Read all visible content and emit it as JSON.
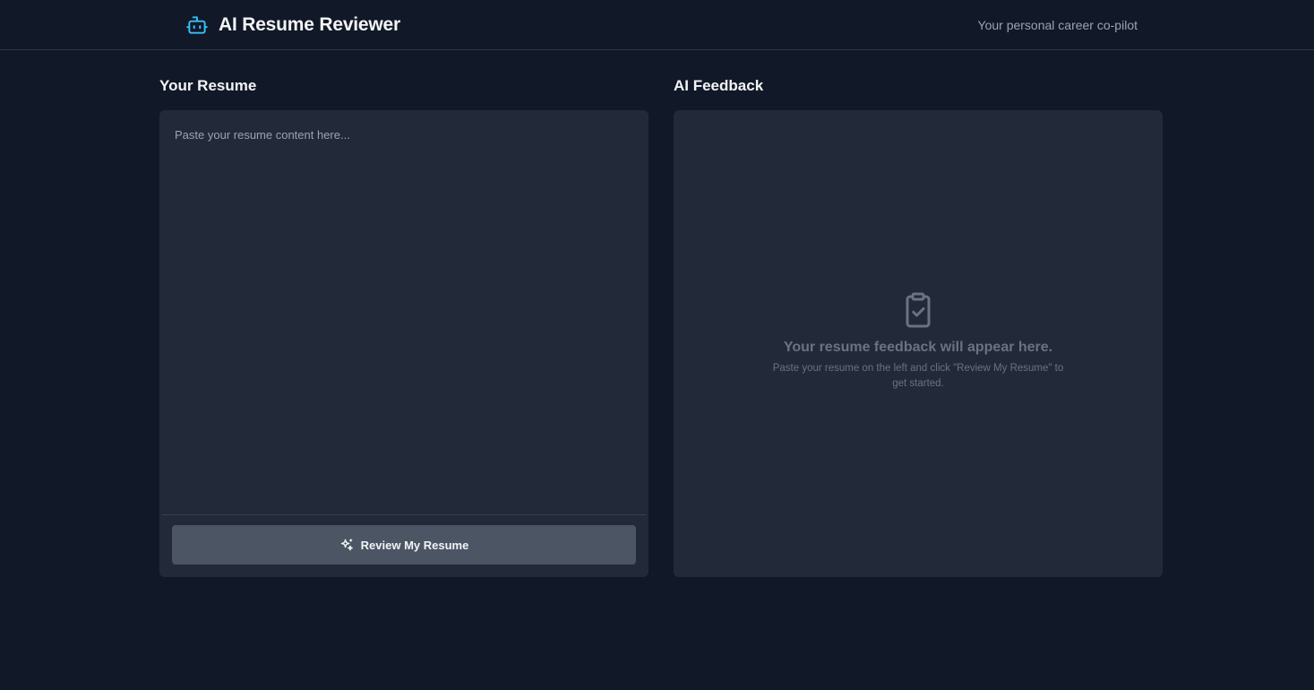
{
  "header": {
    "brand_icon": "robot-icon",
    "title": "AI Resume Reviewer",
    "tagline": "Your personal career co-pilot",
    "accent_color": "#38bdf8"
  },
  "resume": {
    "section_title": "Your Resume",
    "input_value": "",
    "input_placeholder": "Paste your resume content here...",
    "button_icon": "sparkles-icon",
    "button_label": "Review My Resume"
  },
  "feedback": {
    "section_title": "AI Feedback",
    "empty_icon": "clipboard-check-icon",
    "empty_title": "Your resume feedback will appear here.",
    "empty_desc": "Paste your resume on the left and click \"Review My Resume\" to get started."
  }
}
